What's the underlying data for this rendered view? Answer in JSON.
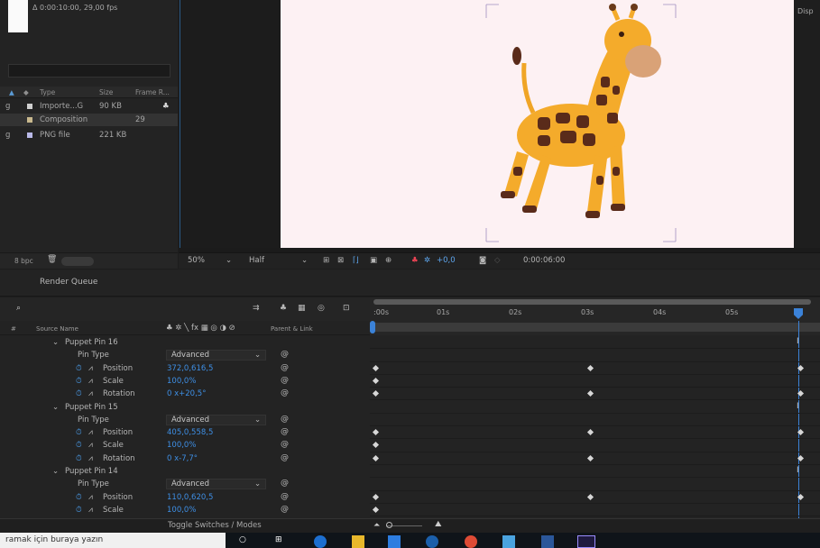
{
  "project": {
    "info": "Δ 0:00:10:00, 29,00 fps",
    "headers": {
      "type": "Type",
      "size": "Size",
      "frame_rate": "Frame R..."
    },
    "items": [
      {
        "name_tail": "g",
        "type": "Importe...G",
        "size": "90 KB",
        "fps": "",
        "color": "#cfcfcf"
      },
      {
        "name_tail": "",
        "type": "Composition",
        "size": "",
        "fps": "29",
        "color": "#c9b98e"
      },
      {
        "name_tail": "g",
        "type": "PNG file",
        "size": "221 KB",
        "fps": "",
        "color": "#b9b9e8"
      }
    ],
    "bpc": "8 bpc"
  },
  "viewer": {
    "zoom": "50%",
    "resolution": "Half",
    "exposure": "+0,0",
    "timecode": "0:00:06:00",
    "right_label": "Disp"
  },
  "tabs": {
    "render_queue": "Render Queue"
  },
  "timeline": {
    "search_placeholder": "",
    "col_source": "Source Name",
    "col_switches": "♣ ✲ ╲ fx ▦ ◎ ◑ ⊘",
    "col_parent": "Parent & Link",
    "ticks": [
      ":00s",
      "01s",
      "02s",
      "03s",
      "04s",
      "05s",
      "0"
    ],
    "layers": [
      {
        "kind": "group",
        "name": "Puppet Pin 16"
      },
      {
        "kind": "type",
        "name": "Pin Type",
        "value": "Advanced"
      },
      {
        "kind": "prop",
        "name": "Position",
        "value": "372,0,616,5",
        "keys": [
          0,
          1,
          2
        ]
      },
      {
        "kind": "prop",
        "name": "Scale",
        "value": "100,0%",
        "keys": [
          0
        ]
      },
      {
        "kind": "prop",
        "name": "Rotation",
        "value": "0 x+20,5°",
        "keys": [
          0,
          1,
          2
        ]
      },
      {
        "kind": "group",
        "name": "Puppet Pin 15"
      },
      {
        "kind": "type",
        "name": "Pin Type",
        "value": "Advanced"
      },
      {
        "kind": "prop",
        "name": "Position",
        "value": "405,0,558,5",
        "keys": [
          0,
          1,
          2
        ]
      },
      {
        "kind": "prop",
        "name": "Scale",
        "value": "100,0%",
        "keys": [
          0
        ]
      },
      {
        "kind": "prop",
        "name": "Rotation",
        "value": "0 x-7,7°",
        "keys": [
          0,
          1,
          2
        ]
      },
      {
        "kind": "group",
        "name": "Puppet Pin 14"
      },
      {
        "kind": "type",
        "name": "Pin Type",
        "value": "Advanced"
      },
      {
        "kind": "prop",
        "name": "Position",
        "value": "110,0,620,5",
        "keys": [
          0,
          1,
          2
        ]
      },
      {
        "kind": "prop",
        "name": "Scale",
        "value": "100,0%",
        "keys": [
          0
        ]
      }
    ],
    "toggle_label": "Toggle Switches / Modes"
  },
  "taskbar": {
    "search_text": "ramak için buraya yazın"
  }
}
